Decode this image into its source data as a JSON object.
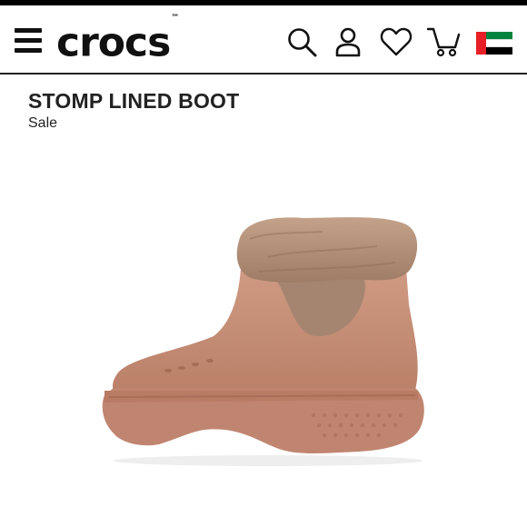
{
  "header": {
    "brand": "crocs",
    "trademark": "™",
    "icons": [
      "menu-icon",
      "search-icon",
      "account-icon",
      "heart-icon",
      "cart-icon",
      "uae-flag-icon"
    ],
    "flag_colors": {
      "red": "#e81f26",
      "green": "#00843d",
      "white": "#ffffff",
      "black": "#000000"
    }
  },
  "product": {
    "name": "STOMP LINED BOOT",
    "tag": "Sale",
    "image_icon": "boot-image",
    "colors": {
      "boot": "#c68f78",
      "fur": "#b6937b"
    }
  }
}
